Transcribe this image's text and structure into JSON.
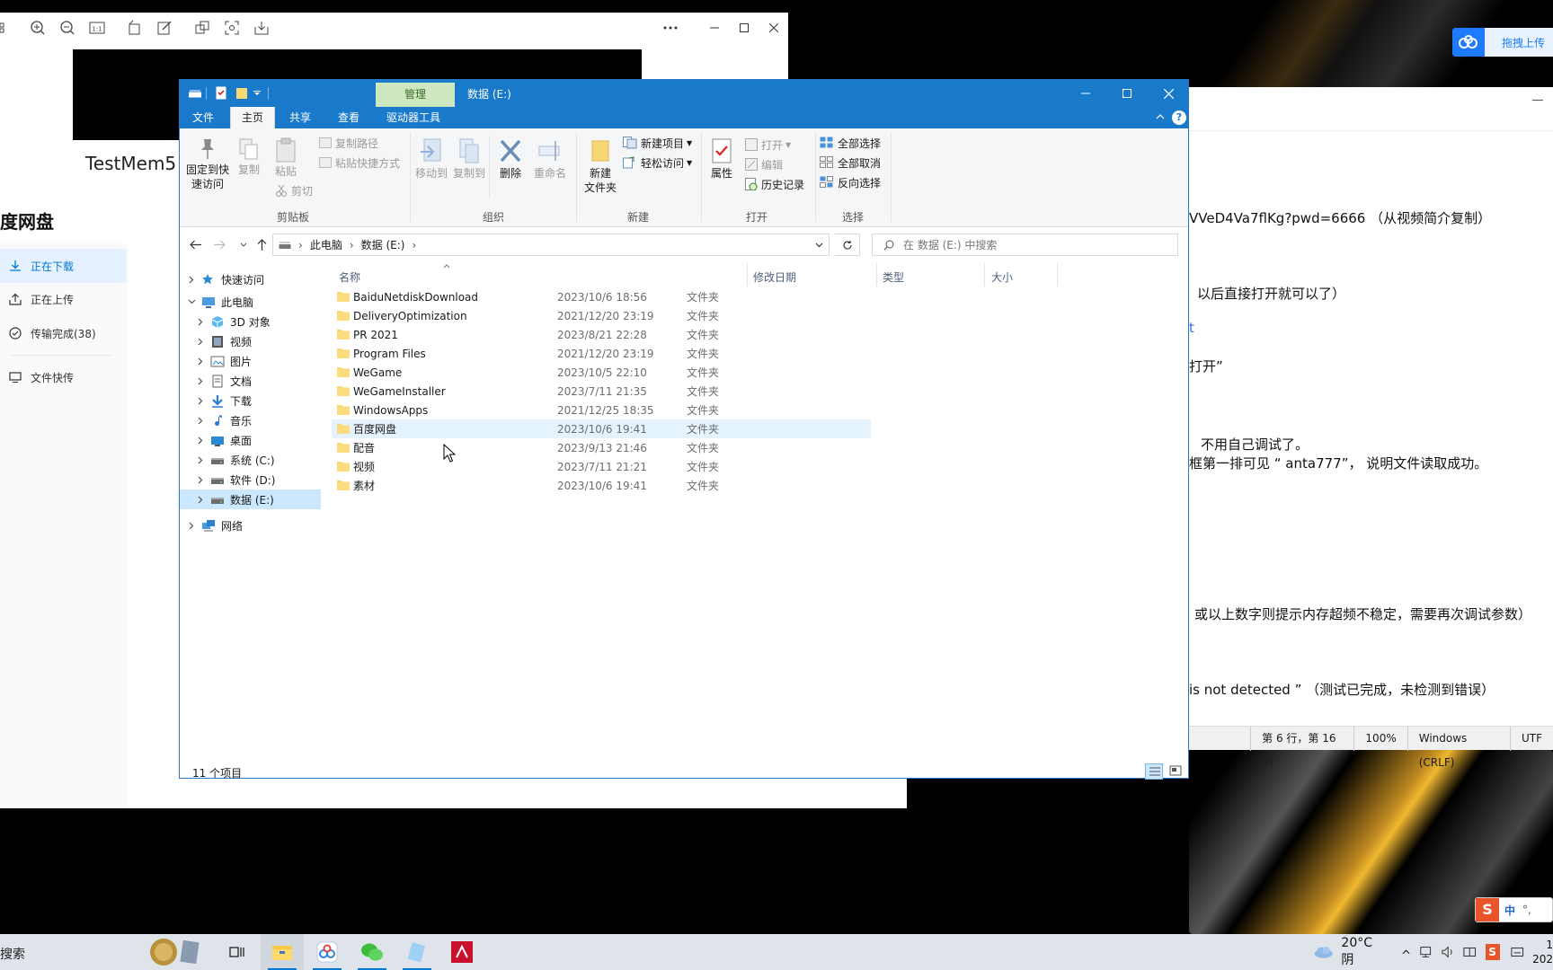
{
  "viewer": {
    "label": "TestMem5"
  },
  "netdisk": {
    "title": "度网盘",
    "items": [
      {
        "label": "正在下载"
      },
      {
        "label": "正在上传"
      },
      {
        "label": "传输完成(38)"
      },
      {
        "label": "文件快传"
      }
    ]
  },
  "upload": {
    "label": "拖拽上传"
  },
  "notepad": {
    "lines": [
      "VVeD4Va7flKg?pwd=6666 （从视频简介复制）",
      "以后直接打开就可以了）",
      "t",
      "打开”",
      "不用自己调试了。",
      "框第一排可见 “ anta777”， 说明文件读取成功。",
      "或以上数字则提示内存超频不稳定，需要再次调试参数）",
      "is not detected ”  （测试已完成，未检测到错误）"
    ],
    "status": {
      "position": "第 6 行，第 16 列",
      "zoom": "100%",
      "eol": "Windows (CRLF)",
      "enc": "UTF"
    }
  },
  "explorer": {
    "title": "数据 (E:)",
    "manage_tab": "管理",
    "tabs": {
      "file": "文件",
      "home": "主页",
      "share": "共享",
      "view": "查看",
      "drive": "驱动器工具"
    },
    "ribbon": {
      "pin": "固定到快\n速访问",
      "copy": "复制",
      "paste": "粘贴",
      "copy_path": "复制路径",
      "paste_shortcut": "粘贴快捷方式",
      "cut": "剪切",
      "clipboard": "剪贴板",
      "move_to": "移动到",
      "copy_to": "复制到",
      "delete": "删除",
      "rename": "重命名",
      "organize": "组织",
      "new_folder": "新建\n文件夹",
      "new_item": "新建项目",
      "easy_access": "轻松访问",
      "new": "新建",
      "properties": "属性",
      "open": "打开",
      "edit": "编辑",
      "history": "历史记录",
      "open_group": "打开",
      "select_all": "全部选择",
      "select_none": "全部取消",
      "invert": "反向选择",
      "select": "选择"
    },
    "address": {
      "pc": "此电脑",
      "drive": "数据 (E:)"
    },
    "search_placeholder": "在 数据 (E:) 中搜索",
    "nav": [
      {
        "label": "快速访问",
        "icon": "star-icon"
      },
      {
        "label": "此电脑",
        "icon": "computer-icon"
      },
      {
        "label": "3D 对象",
        "icon": "cube-icon"
      },
      {
        "label": "视频",
        "icon": "video-icon"
      },
      {
        "label": "图片",
        "icon": "picture-icon"
      },
      {
        "label": "文档",
        "icon": "document-icon"
      },
      {
        "label": "下载",
        "icon": "download-icon"
      },
      {
        "label": "音乐",
        "icon": "music-icon"
      },
      {
        "label": "桌面",
        "icon": "desktop-icon"
      },
      {
        "label": "系统 (C:)",
        "icon": "drive-icon"
      },
      {
        "label": "软件 (D:)",
        "icon": "drive-icon"
      },
      {
        "label": "数据 (E:)",
        "icon": "drive-icon"
      },
      {
        "label": "网络",
        "icon": "network-icon"
      }
    ],
    "columns": {
      "name": "名称",
      "date": "修改日期",
      "type": "类型",
      "size": "大小"
    },
    "files": [
      {
        "name": "BaiduNetdiskDownload",
        "date": "2023/10/6 18:56",
        "type": "文件夹"
      },
      {
        "name": "DeliveryOptimization",
        "date": "2021/12/20 23:19",
        "type": "文件夹"
      },
      {
        "name": "PR 2021",
        "date": "2023/8/21 22:28",
        "type": "文件夹"
      },
      {
        "name": "Program Files",
        "date": "2021/12/20 23:19",
        "type": "文件夹"
      },
      {
        "name": "WeGame",
        "date": "2023/10/5 22:10",
        "type": "文件夹"
      },
      {
        "name": "WeGameInstaller",
        "date": "2023/7/11 21:35",
        "type": "文件夹"
      },
      {
        "name": "WindowsApps",
        "date": "2021/12/25 18:35",
        "type": "文件夹"
      },
      {
        "name": "百度网盘",
        "date": "2023/10/6 19:41",
        "type": "文件夹"
      },
      {
        "name": "配音",
        "date": "2023/9/13 21:46",
        "type": "文件夹"
      },
      {
        "name": "视频",
        "date": "2023/7/11 21:21",
        "type": "文件夹"
      },
      {
        "name": "素材",
        "date": "2023/10/6 19:41",
        "type": "文件夹"
      }
    ],
    "status": "11 个项目"
  },
  "taskbar": {
    "search": "搜索",
    "weather": "20°C 阴",
    "ime": "中",
    "time": "1",
    "date": "202"
  },
  "colors": {
    "accent": "#1979ca",
    "manage": "#cfe8c2",
    "selection": "#cce8ff",
    "folder": "#f8d775"
  }
}
